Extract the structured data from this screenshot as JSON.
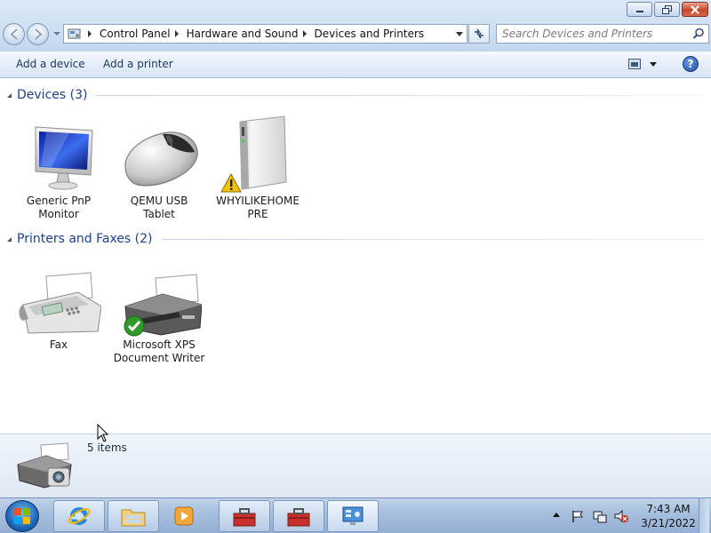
{
  "window": {
    "minimize_label": "Minimize",
    "maximize_label": "Maximize",
    "close_label": "Close"
  },
  "address": {
    "breadcrumbs": [
      "Control Panel",
      "Hardware and Sound",
      "Devices and Printers"
    ]
  },
  "search": {
    "placeholder": "Search Devices and Printers"
  },
  "commandbar": {
    "add_device": "Add a device",
    "add_printer": "Add a printer"
  },
  "groups": {
    "devices": {
      "title": "Devices (3)",
      "items": [
        {
          "label_line1": "Generic PnP",
          "label_line2": "Monitor",
          "icon": "monitor-icon"
        },
        {
          "label_line1": "QEMU USB",
          "label_line2": "Tablet",
          "icon": "mouse-icon"
        },
        {
          "label_line1": "WHYILIKEHOME",
          "label_line2": "PRE",
          "icon": "computer-tower-icon",
          "badge": "warning"
        }
      ]
    },
    "printers": {
      "title": "Printers and Faxes (2)",
      "items": [
        {
          "label_line1": "Fax",
          "label_line2": "",
          "icon": "fax-icon"
        },
        {
          "label_line1": "Microsoft XPS",
          "label_line2": "Document Writer",
          "icon": "printer-icon",
          "badge": "default-check"
        }
      ]
    }
  },
  "details": {
    "count": "5 items"
  },
  "taskbar": {
    "pinned": [
      "internet-explorer-icon",
      "explorer-folder-icon",
      "media-player-icon",
      "toolbox-icon",
      "toolbox-icon",
      "control-panel-icon"
    ],
    "clock_time": "7:43 AM",
    "clock_date": "3/21/2022"
  },
  "colors": {
    "accent": "#1e3f8a",
    "warning": "#f2c200",
    "check": "#2f9a2b"
  }
}
